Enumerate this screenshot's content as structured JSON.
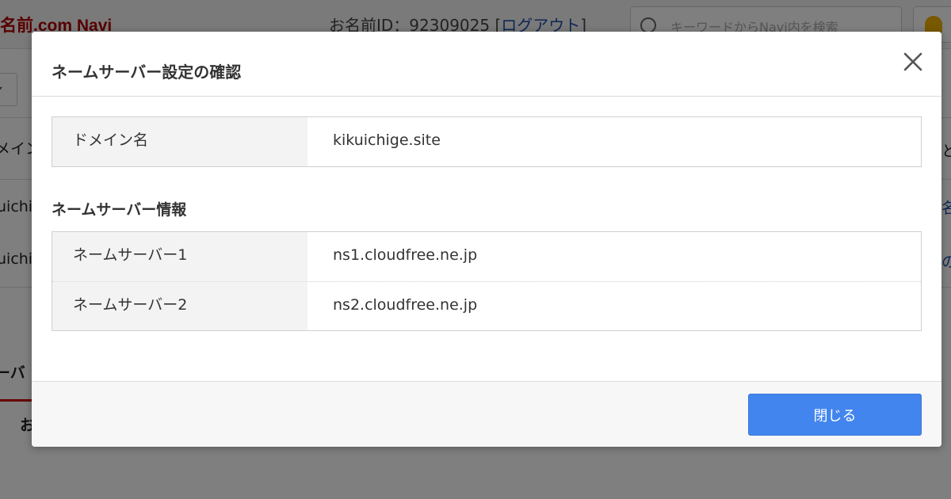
{
  "background": {
    "logo": "名前.com Navi",
    "account_prefix": "お名前ID：92309025 [",
    "logout_label": "ログアウト",
    "account_suffix": "]",
    "search_placeholder": "キーワードからNavi内を検索",
    "fragments": {
      "left_1": "メイン",
      "left_2": "uichi",
      "left_3": "uichi",
      "left_4": "ーバ",
      "left_5": "お",
      "right_1": "との",
      "right_2": "名",
      "right_3": "の"
    }
  },
  "modal": {
    "title": "ネームサーバー設定の確認",
    "domain_label": "ドメイン名",
    "domain_value": "kikuichige.site",
    "ns_heading": "ネームサーバー情報",
    "ns_rows": [
      {
        "label": "ネームサーバー1",
        "value": "ns1.cloudfree.ne.jp"
      },
      {
        "label": "ネームサーバー2",
        "value": "ns2.cloudfree.ne.jp"
      }
    ],
    "close_button_label": "閉じる"
  },
  "colors": {
    "primary": "#4285ee",
    "logo": "#b00000",
    "overlay": "rgba(0,0,0,0.5)"
  }
}
